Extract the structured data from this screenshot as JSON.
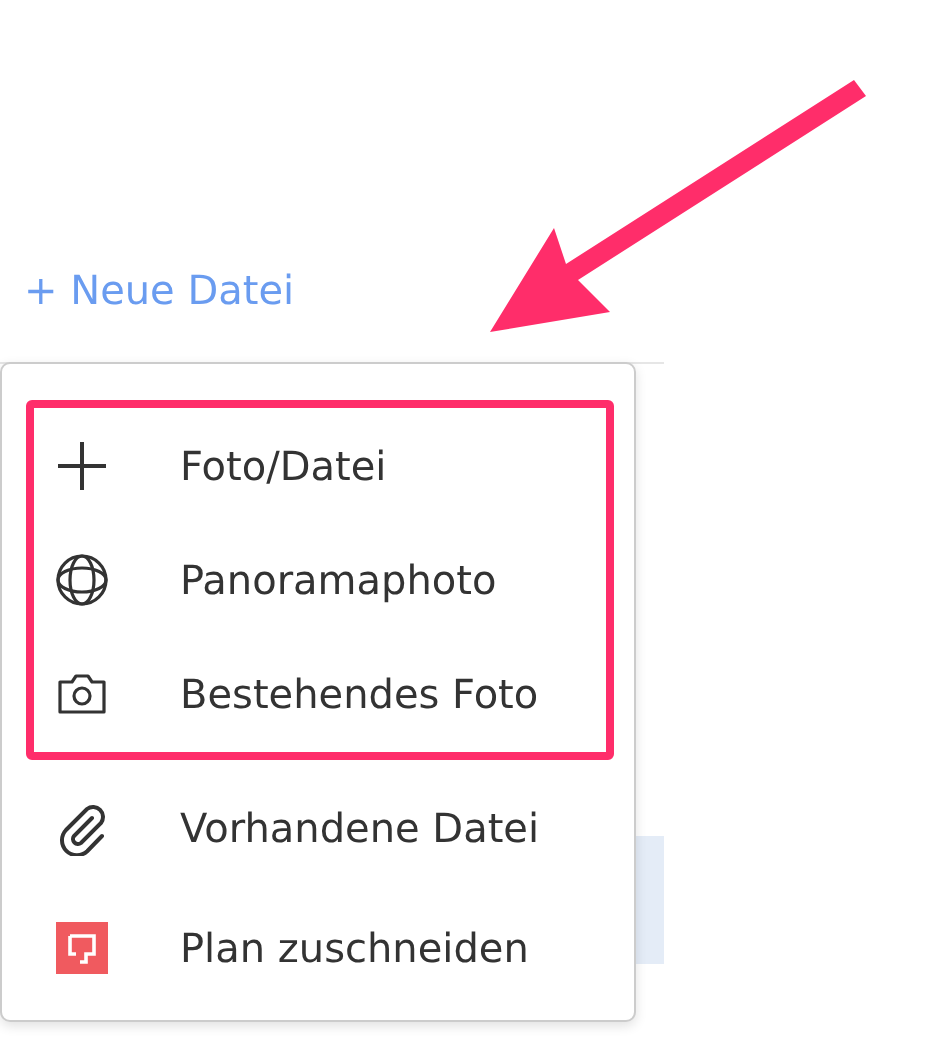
{
  "new_file_link": "+ Neue Datei",
  "menu": {
    "groups": [
      {
        "highlighted": true,
        "items": [
          {
            "kind": "add",
            "label": "Foto/Datei"
          },
          {
            "kind": "panorama",
            "label": "Panoramaphoto"
          },
          {
            "kind": "camera",
            "label": "Bestehendes Foto"
          }
        ]
      },
      {
        "highlighted": false,
        "items": [
          {
            "kind": "attachment",
            "label": "Vorhandene Datei"
          },
          {
            "kind": "crop-plan",
            "label": "Plan zuschneiden"
          }
        ]
      }
    ]
  },
  "annotation": {
    "arrow": true
  }
}
